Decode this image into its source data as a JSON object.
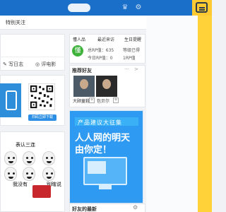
{
  "header": {
    "crown_icon": "crown-icon",
    "settings_icon": "gear-icon",
    "message_icon": "message-face-icon"
  },
  "tabs": {
    "special_follow": "特别关注"
  },
  "post": {
    "write_log": "写日志",
    "comment_movie": "评电影"
  },
  "qr": {
    "download": "扫码立即下载"
  },
  "meme": {
    "title": "表认三连",
    "caption_left": "我没有",
    "caption_right": "别瞎说"
  },
  "profile": {
    "tabs": [
      "懂人品",
      "最近来访",
      "生日提醒"
    ],
    "avatar": "懂",
    "stats": [
      "总RP值：635",
      "今日RP值：0",
      "等级已得",
      "1RP值"
    ]
  },
  "friends": {
    "title": "推荐好友",
    "more": "···",
    "arrow": ">",
    "names": [
      "大顾童鞋",
      "包贝尔"
    ]
  },
  "ad": {
    "top": "产品建议大征集",
    "line1": "人人网的明天",
    "line2": "由你定！"
  },
  "news": {
    "title": "好友的最新"
  },
  "colors": {
    "topbar": "#1a6fc9",
    "accent": "#ffd23a",
    "ad_blue": "#2e9af2",
    "avatar_green": "#3fb23c"
  }
}
